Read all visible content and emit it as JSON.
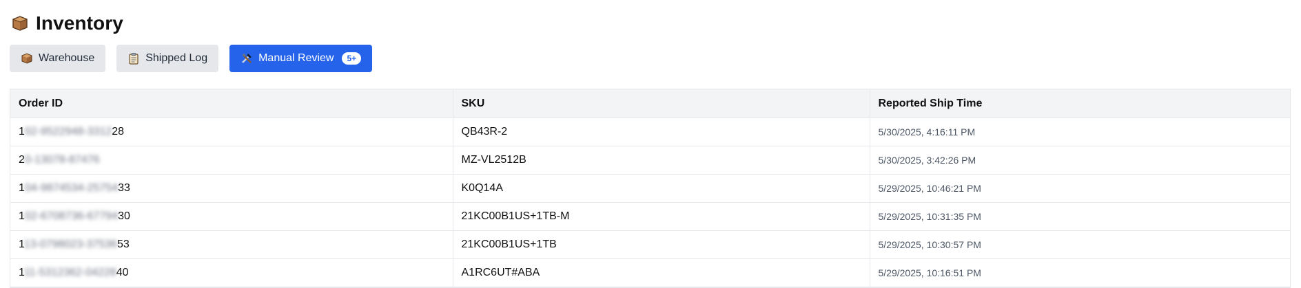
{
  "app": {
    "title": "Inventory"
  },
  "tabs": [
    {
      "label": "Warehouse",
      "icon": "box-icon",
      "active": false
    },
    {
      "label": "Shipped Log",
      "icon": "clipboard-icon",
      "active": false
    },
    {
      "label": "Manual Review",
      "icon": "tools-icon",
      "active": true,
      "badge": "5+"
    }
  ],
  "table": {
    "columns": [
      "Order ID",
      "SKU",
      "Reported Ship Time"
    ],
    "rows": [
      {
        "order_id_start": "1",
        "order_id_hidden": "02-9522948-3312",
        "order_id_end": "28",
        "sku": "QB43R-2",
        "time": "5/30/2025, 4:16:11 PM"
      },
      {
        "order_id_start": "2",
        "order_id_hidden": "0-13078-87476",
        "order_id_end": "",
        "sku": "MZ-VL2512B",
        "time": "5/30/2025, 3:42:26 PM"
      },
      {
        "order_id_start": "1",
        "order_id_hidden": "04-9874534-25754",
        "order_id_end": "33",
        "sku": "K0Q14A",
        "time": "5/29/2025, 10:46:21 PM"
      },
      {
        "order_id_start": "1",
        "order_id_hidden": "02-6708736-67794",
        "order_id_end": "30",
        "sku": "21KC00B1US+1TB-M",
        "time": "5/29/2025, 10:31:35 PM"
      },
      {
        "order_id_start": "1",
        "order_id_hidden": "13-0798023-37536",
        "order_id_end": "53",
        "sku": "21KC00B1US+1TB",
        "time": "5/29/2025, 10:30:57 PM"
      },
      {
        "order_id_start": "1",
        "order_id_hidden": "11-5312362-04228",
        "order_id_end": "40",
        "sku": "A1RC6UT#ABA",
        "time": "5/29/2025, 10:16:51 PM"
      }
    ]
  },
  "colors": {
    "accent": "#2563eb",
    "tab_inactive": "#e5e7eb",
    "header_bg": "#f3f4f6"
  }
}
